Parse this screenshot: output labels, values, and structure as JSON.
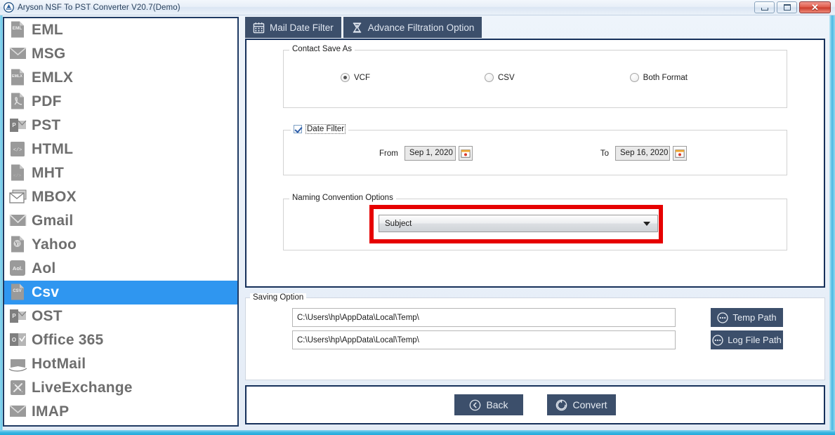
{
  "window": {
    "title": "Aryson NSF To PST Converter V20.7(Demo)",
    "app_icon": "app-logo-icon",
    "controls": [
      {
        "name": "minimize",
        "glyph": "minimize-icon"
      },
      {
        "name": "maximize",
        "glyph": "restore-icon"
      },
      {
        "name": "close",
        "glyph": "close-icon",
        "label": "✕",
        "color": "#d13b2b"
      }
    ]
  },
  "sidebar": {
    "selected_index": 11,
    "items": [
      {
        "label": "EML",
        "icon": "eml-file-icon"
      },
      {
        "label": "MSG",
        "icon": "msg-envelope-icon"
      },
      {
        "label": "EMLX",
        "icon": "emlx-file-icon"
      },
      {
        "label": "PDF",
        "icon": "pdf-file-icon"
      },
      {
        "label": "PST",
        "icon": "pst-outlook-icon"
      },
      {
        "label": "HTML",
        "icon": "html-code-file-icon"
      },
      {
        "label": "MHT",
        "icon": "mht-code-file-icon"
      },
      {
        "label": "MBOX",
        "icon": "mbox-envelopes-icon"
      },
      {
        "label": "Gmail",
        "icon": "gmail-envelope-icon"
      },
      {
        "label": "Yahoo",
        "icon": "yahoo-file-icon"
      },
      {
        "label": "Aol",
        "icon": "aol-file-icon"
      },
      {
        "label": "Csv",
        "icon": "csv-file-icon"
      },
      {
        "label": "OST",
        "icon": "ost-outlook-icon"
      },
      {
        "label": "Office 365",
        "icon": "office365-icon"
      },
      {
        "label": "HotMail",
        "icon": "hotmail-envelope-icon"
      },
      {
        "label": "LiveExchange",
        "icon": "live-exchange-icon"
      },
      {
        "label": "IMAP",
        "icon": "imap-envelope-icon"
      }
    ]
  },
  "tabs": [
    {
      "label": "Mail Date Filter",
      "icon": "calendar-icon",
      "active": true
    },
    {
      "label": "Advance Filtration Option",
      "icon": "filter-hourglass-icon",
      "active": false
    }
  ],
  "contact_save_as": {
    "title": "Contact Save As",
    "options": [
      {
        "label": "VCF",
        "checked": true
      },
      {
        "label": "CSV",
        "checked": false
      },
      {
        "label": "Both Format",
        "checked": false
      }
    ]
  },
  "date_filter": {
    "title": "Date Filter",
    "enabled": true,
    "from_label": "From",
    "from_value": "Sep 1, 2020",
    "to_label": "To",
    "to_value": "Sep 16, 2020",
    "calendar_icon": "calendar-picker-icon"
  },
  "naming_convention": {
    "title": "Naming Convention Options",
    "selected": "Subject",
    "highlight_color": "#e60000",
    "dropdown_arrow": "chevron-down-icon"
  },
  "saving_option": {
    "title": "Saving Option",
    "temp_path_value": "C:\\Users\\hp\\AppData\\Local\\Temp\\",
    "log_path_value": "C:\\Users\\hp\\AppData\\Local\\Temp\\",
    "temp_path_button": "Temp Path",
    "log_path_button": "Log File Path",
    "button_icon": "ellipsis-circle-icon"
  },
  "actions": {
    "back_label": "Back",
    "back_icon": "back-circle-icon",
    "convert_label": "Convert",
    "convert_icon": "convert-circle-icon"
  },
  "theme": {
    "accent_navy": "#3c4f6b",
    "panel_border": "#16305a",
    "selection_blue": "#2f96f0",
    "frame_cyan": "#38b6e2"
  }
}
